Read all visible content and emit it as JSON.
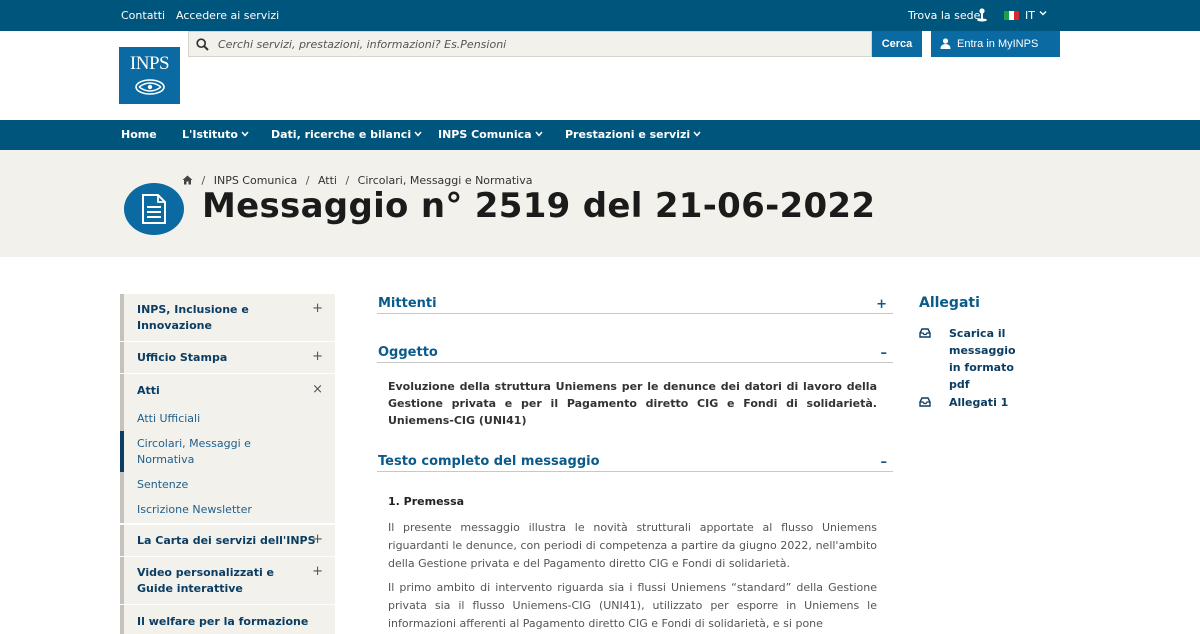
{
  "topbar": {
    "contatti": "Contatti",
    "accedere": "Accedere ai servizi",
    "trova_sede": "Trova la sede",
    "language": "IT"
  },
  "header": {
    "logo_text": "INPS",
    "search_placeholder": "Cerchi servizi, prestazioni, informazioni? Es.Pensioni",
    "search_button": "Cerca",
    "login_button": "Entra in MyINPS"
  },
  "nav": {
    "items": [
      {
        "label": "Home"
      },
      {
        "label": "L'Istituto"
      },
      {
        "label": "Dati, ricerche e bilanci"
      },
      {
        "label": "INPS Comunica"
      },
      {
        "label": "Prestazioni e servizi"
      }
    ]
  },
  "breadcrumb": [
    "INPS Comunica",
    "Atti",
    "Circolari, Messaggi e Normativa"
  ],
  "page": {
    "title": "Messaggio n° 2519 del 21-06-2022"
  },
  "sidebar": {
    "items": [
      {
        "label": "INPS, Inclusione e Innovazione",
        "toggle": "+"
      },
      {
        "label": "Ufficio Stampa",
        "toggle": "+"
      },
      {
        "label": "Atti",
        "toggle": "×"
      },
      {
        "label": "La Carta dei servizi dell'INPS",
        "toggle": "+"
      },
      {
        "label": "Video personalizzati e Guide interattive",
        "toggle": "+"
      },
      {
        "label": "Il welfare per la formazione"
      }
    ],
    "subitems": [
      {
        "label": "Atti Ufficiali"
      },
      {
        "label": "Circolari, Messaggi e Normativa"
      },
      {
        "label": "Sentenze"
      },
      {
        "label": "Iscrizione Newsletter"
      }
    ]
  },
  "sections": {
    "mittenti": {
      "label": "Mittenti",
      "toggle": "+"
    },
    "oggetto": {
      "label": "Oggetto",
      "toggle": "–",
      "text": "Evoluzione della struttura Uniemens per le denunce dei datori di lavoro della Gestione privata e per il Pagamento diretto CIG e Fondi di solidarietà. Uniemens-CIG (UNI41)"
    },
    "testo": {
      "label": "Testo completo del messaggio",
      "toggle": "–"
    }
  },
  "content": {
    "heading": "1. Premessa",
    "paragraphs": [
      "Il presente messaggio illustra le novità strutturali apportate al flusso Uniemens riguardanti le denunce, con periodi di competenza a partire da giugno 2022, nell'ambito della Gestione privata e del Pagamento diretto CIG e Fondi di solidarietà.",
      "Il primo ambito di intervento riguarda sia i flussi Uniemens “standard” della Gestione privata sia il flusso Uniemens-CIG (UNI41), utilizzato per esporre in Uniemens le informazioni afferenti al Pagamento diretto CIG e Fondi di solidarietà, e si pone"
    ]
  },
  "allegati": {
    "title": "Allegati",
    "items": [
      {
        "label": "Scarica il messaggio in formato pdf"
      },
      {
        "label": "Allegati 1"
      }
    ]
  },
  "colors": {
    "primary_dark": "#00557d",
    "primary": "#0a6aa1",
    "band_bg": "#f2f1ec"
  }
}
